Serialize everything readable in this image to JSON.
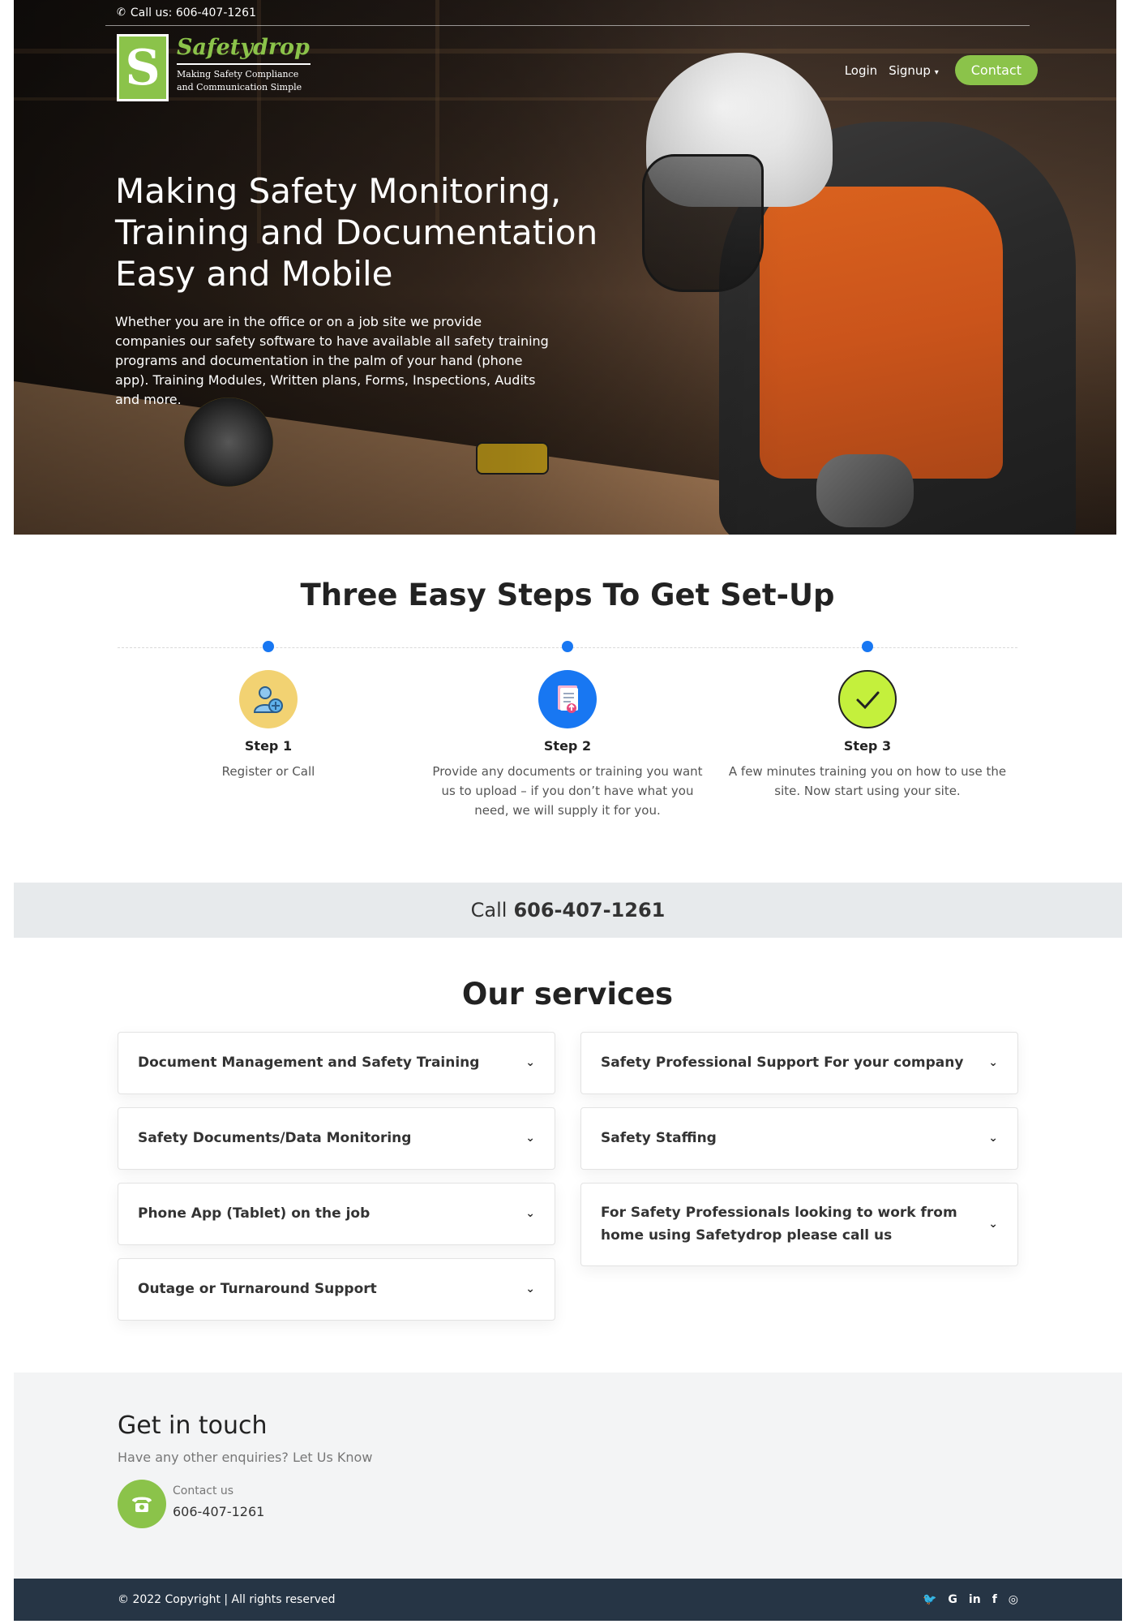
{
  "topbar": {
    "phone_text": "Call us: 606-407-1261"
  },
  "logo": {
    "letter": "S",
    "name": "Safetydrop",
    "tagline": "Making Safety Compliance and Communication Simple"
  },
  "nav": {
    "login": "Login",
    "signup": "Signup",
    "contact": "Contact"
  },
  "hero": {
    "title": "Making Safety Monitoring, Training and Documentation Easy and Mobile",
    "description": "Whether you are in the office or on a job site we provide companies our safety software to have available all safety training programs and documentation in the palm of your hand (phone app). Training Modules, Written plans, Forms, Inspections, Audits and more."
  },
  "steps": {
    "title": "Three Easy Steps To Get Set-Up",
    "items": [
      {
        "label": "Step 1",
        "desc": "Register or Call",
        "icon": "add-user-icon"
      },
      {
        "label": "Step 2",
        "desc": "Provide any documents or training you want us to upload – if you don’t have what you need, we will supply it for you.",
        "icon": "document-upload-icon"
      },
      {
        "label": "Step 3",
        "desc": "A few minutes training you on how to use the site. Now start using your site.",
        "icon": "checkmark-icon"
      }
    ]
  },
  "callbar": {
    "prefix": "Call",
    "number": "606-407-1261"
  },
  "services": {
    "title": "Our services",
    "left": [
      "Document Management and Safety Training",
      "Safety Documents/Data Monitoring",
      "Phone App (Tablet) on the job",
      "Outage or Turnaround Support"
    ],
    "right": [
      "Safety Professional Support For your company",
      "Safety Staffing",
      "For Safety Professionals looking to work from home using Safetydrop please call us"
    ]
  },
  "contact": {
    "title": "Get in touch",
    "subtitle": "Have any other enquiries? Let Us Know",
    "label": "Contact us",
    "number": "606-407-1261"
  },
  "footer": {
    "copyright": "© 2022 Copyright | All rights reserved",
    "social": [
      "twitter-icon",
      "google-icon",
      "linkedin-icon",
      "facebook-icon",
      "instagram-icon"
    ]
  },
  "colors": {
    "brand_green": "#8bc34a",
    "step_dot_blue": "#1877f2",
    "footer_bg": "#263545"
  }
}
